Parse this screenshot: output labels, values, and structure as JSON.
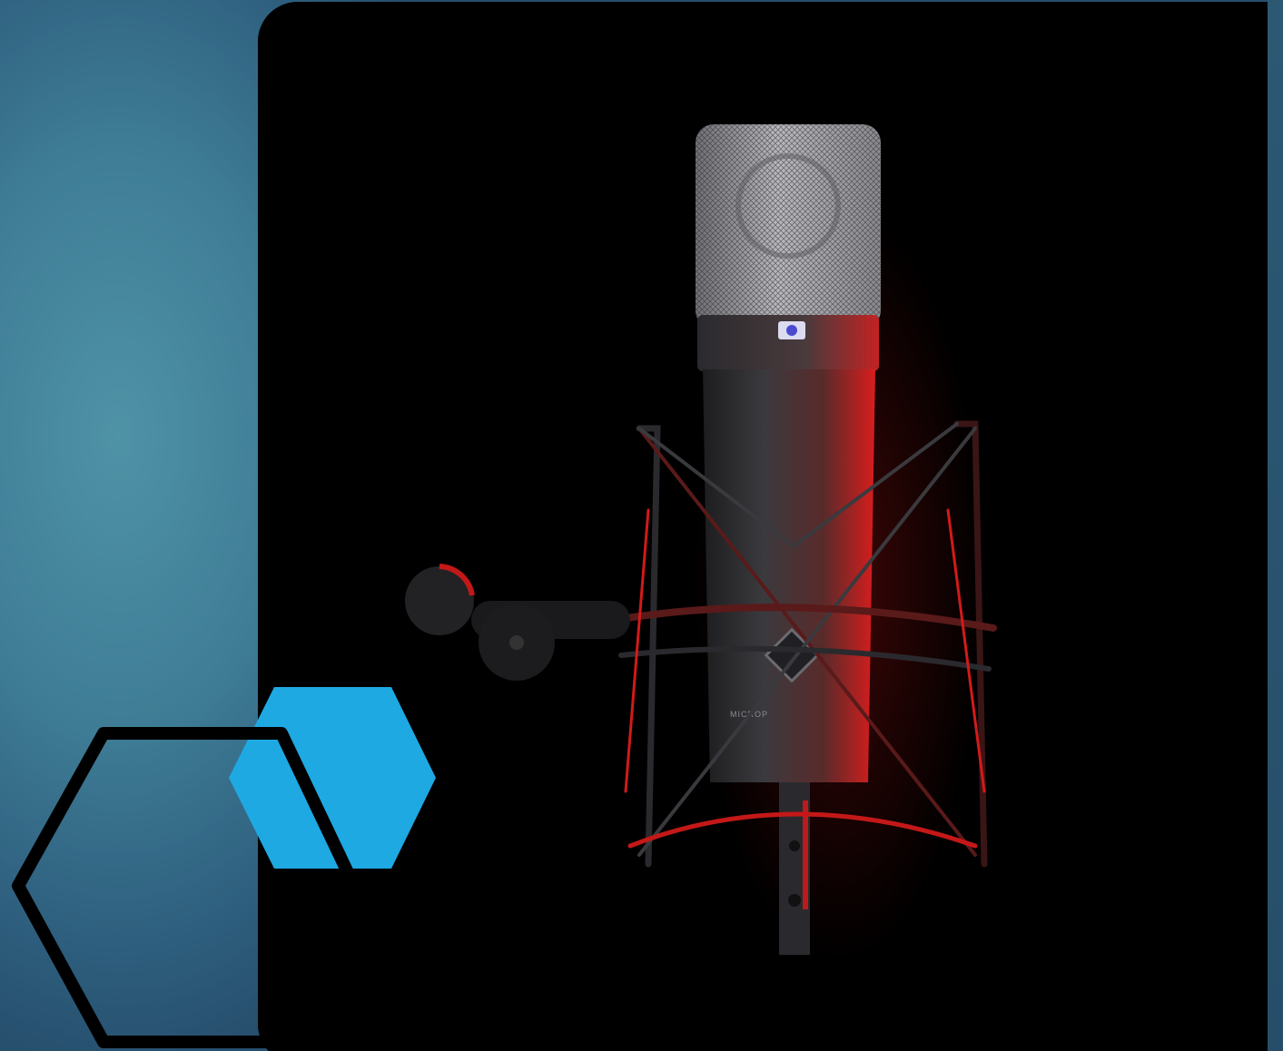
{
  "slide": {
    "background_color": "#3f7d96",
    "photo_subject_icon": "microphone-icon",
    "mic_label": "MICROP",
    "colors": {
      "accent_blue": "#1ea9e3",
      "outline": "#000000",
      "rim_light": "#e0161a",
      "photo_bg": "#000000"
    }
  }
}
